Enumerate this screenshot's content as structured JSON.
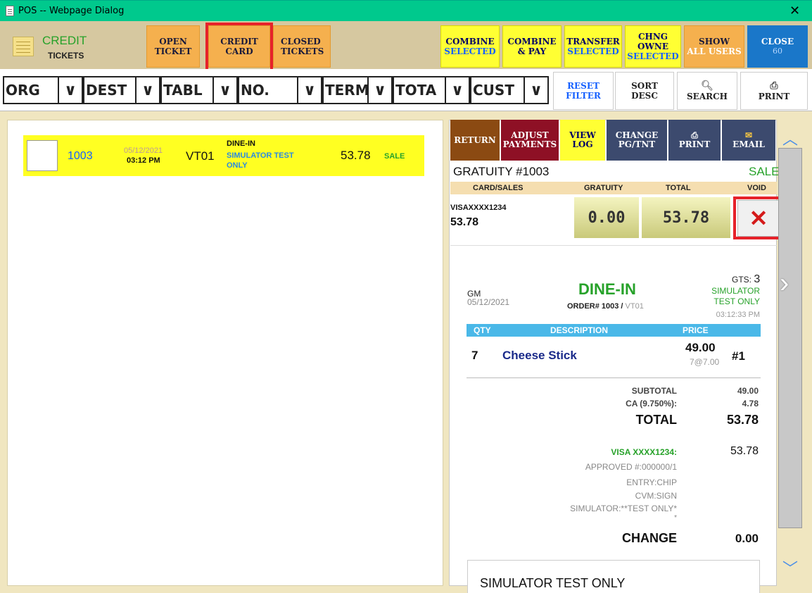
{
  "window": {
    "title": "POS -- Webpage Dialog",
    "close": "✕"
  },
  "header": {
    "section_title": "CREDIT",
    "section_sub": "TICKETS"
  },
  "toolbar": {
    "open_ticket": [
      "OPEN",
      "TICKET"
    ],
    "credit_card": [
      "CREDIT",
      "CARD"
    ],
    "closed_tickets": [
      "CLOSED",
      "TICKETS"
    ],
    "combine_selected": [
      "COMBINE",
      "SELECTED"
    ],
    "combine_pay": [
      "COMBINE",
      "& PAY"
    ],
    "transfer_selected": [
      "TRANSFER",
      "SELECTED"
    ],
    "chng_owner": [
      "CHNG OWNE",
      "SELECTED"
    ],
    "show_all_users": [
      "SHOW",
      "ALL USERS"
    ],
    "close": [
      "CLOSE",
      "60"
    ]
  },
  "filters": [
    {
      "label": "ORG"
    },
    {
      "label": "DEST"
    },
    {
      "label": "TABL"
    },
    {
      "label": "NO."
    },
    {
      "label": "TERM"
    },
    {
      "label": "TOTA"
    },
    {
      "label": "CUST"
    }
  ],
  "filter_actions": {
    "reset": [
      "RESET",
      "FILTER"
    ],
    "sort": [
      "SORT",
      "DESC"
    ],
    "search": "SEARCH",
    "print": "PRINT"
  },
  "ticket": {
    "number": "1003",
    "date": "05/12/2021",
    "time": "03:12 PM",
    "table": "VT01",
    "type": "DINE-IN",
    "customer_line1": "SIMULATOR TEST",
    "customer_line2": "ONLY",
    "amount": "53.78",
    "status": "SALE"
  },
  "detail_actions": {
    "return": "RETURN",
    "adjust": [
      "ADJUST",
      "PAYMENTS"
    ],
    "view_log": [
      "VIEW",
      "LOG"
    ],
    "change_pg": [
      "CHANGE",
      "PG/TNT"
    ],
    "print": "PRINT",
    "email": "EMAIL"
  },
  "gratuity": {
    "title": "GRATUITY #1003",
    "status": "SALE",
    "col_card": "CARD/SALES",
    "col_gratuity": "GRATUITY",
    "col_total": "TOTAL",
    "col_void": "VOID",
    "card": "VISAXXXX1234",
    "card_amount": "53.78",
    "gratuity_value": "0.00",
    "total_value": "53.78"
  },
  "receipt": {
    "server": "GM",
    "date": "05/12/2021",
    "order_type": "DINE-IN",
    "order_label": "ORDER# 1003 / ",
    "order_table": "VT01",
    "gts_label": "GTS:",
    "gts_value": "3",
    "customer1": "SIMULATOR",
    "customer2": "TEST ONLY",
    "time": "03:12:33 PM",
    "col_qty": "QTY",
    "col_desc": "DESCRIPTION",
    "col_price": "PRICE",
    "item_qty": "7",
    "item_name": "Cheese Stick",
    "item_price": "49.00",
    "item_unit": "7@7.00",
    "item_seat": "#1",
    "subtotal_label": "SUBTOTAL",
    "subtotal": "49.00",
    "tax_label": "CA (9.750%):",
    "tax": "4.78",
    "total_label": "TOTAL",
    "total": "53.78",
    "payment_label": "VISA XXXX1234:",
    "payment": "53.78",
    "approved": "APPROVED #:000000/1",
    "entry": "ENTRY:CHIP",
    "cvm": "CVM:SIGN",
    "simulator1": "SIMULATOR:**TEST ONLY*",
    "simulator2": "*",
    "change_label": "CHANGE",
    "change": "0.00",
    "footer": "SIMULATOR TEST ONLY"
  },
  "colors": {
    "title_bar": "#00c98d",
    "orange": "#f5b04e",
    "yellow": "#ffff33",
    "highlight": "#e6222a",
    "close_btn": "#1a77c9"
  }
}
